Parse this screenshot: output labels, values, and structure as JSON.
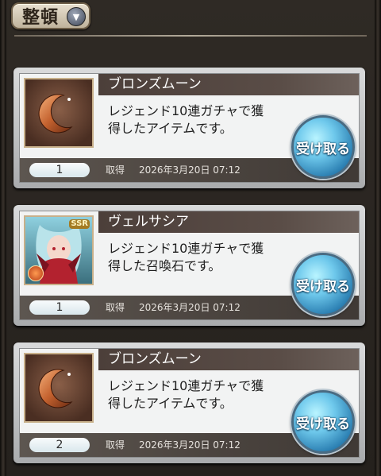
{
  "header": {
    "sort_label": "整頓"
  },
  "items": [
    {
      "name": "ブロンズムーン",
      "desc_line1": "レジェンド10連ガチャで獲",
      "desc_line2": "得したアイテムです。",
      "quantity": "1",
      "acquired_label": "取得",
      "acquired_date": "2026年3月20日 07:12",
      "receive_label": "受け取る",
      "icon": "bronze-moon-icon"
    },
    {
      "name": "ヴェルサシア",
      "desc_line1": "レジェンド10連ガチャで獲",
      "desc_line2": "得した召喚石です。",
      "quantity": "1",
      "acquired_label": "取得",
      "acquired_date": "2026年3月20日 07:12",
      "receive_label": "受け取る",
      "icon": "summon-stone-portrait",
      "badge": "SSR"
    },
    {
      "name": "ブロンズムーン",
      "desc_line1": "レジェンド10連ガチャで獲",
      "desc_line2": "得したアイテムです。",
      "quantity": "2",
      "acquired_label": "取得",
      "acquired_date": "2026年3月20日 07:12",
      "receive_label": "受け取る",
      "icon": "bronze-moon-icon"
    }
  ],
  "colors": {
    "receive_button": "#2b7fb2",
    "name_bar": "#4c3f3a",
    "bottom_bar": "#4a433e"
  }
}
